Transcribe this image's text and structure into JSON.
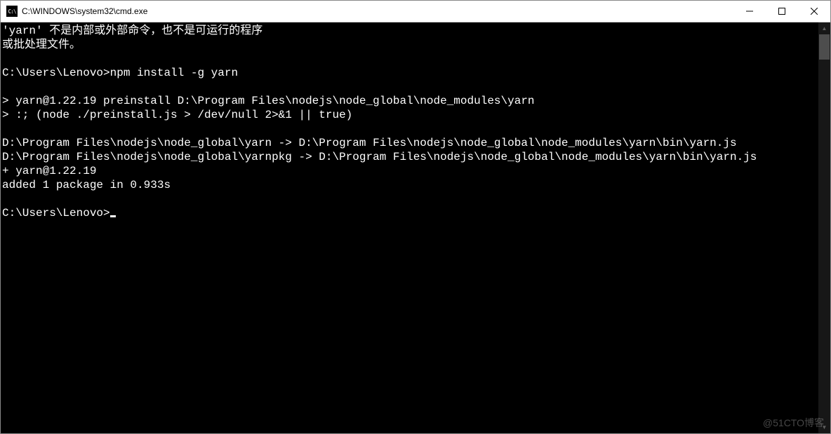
{
  "window": {
    "title": "C:\\WINDOWS\\system32\\cmd.exe",
    "icon_label": "CMD"
  },
  "console": {
    "lines": [
      "'yarn' 不是内部或外部命令，也不是可运行的程序",
      "或批处理文件。",
      "",
      "C:\\Users\\Lenovo>npm install -g yarn",
      "",
      "> yarn@1.22.19 preinstall D:\\Program Files\\nodejs\\node_global\\node_modules\\yarn",
      "> :; (node ./preinstall.js > /dev/null 2>&1 || true)",
      "",
      "D:\\Program Files\\nodejs\\node_global\\yarn -> D:\\Program Files\\nodejs\\node_global\\node_modules\\yarn\\bin\\yarn.js",
      "D:\\Program Files\\nodejs\\node_global\\yarnpkg -> D:\\Program Files\\nodejs\\node_global\\node_modules\\yarn\\bin\\yarn.js",
      "+ yarn@1.22.19",
      "added 1 package in 0.933s",
      "",
      "C:\\Users\\Lenovo>"
    ],
    "show_cursor": true
  },
  "watermark": "@51CTO博客"
}
